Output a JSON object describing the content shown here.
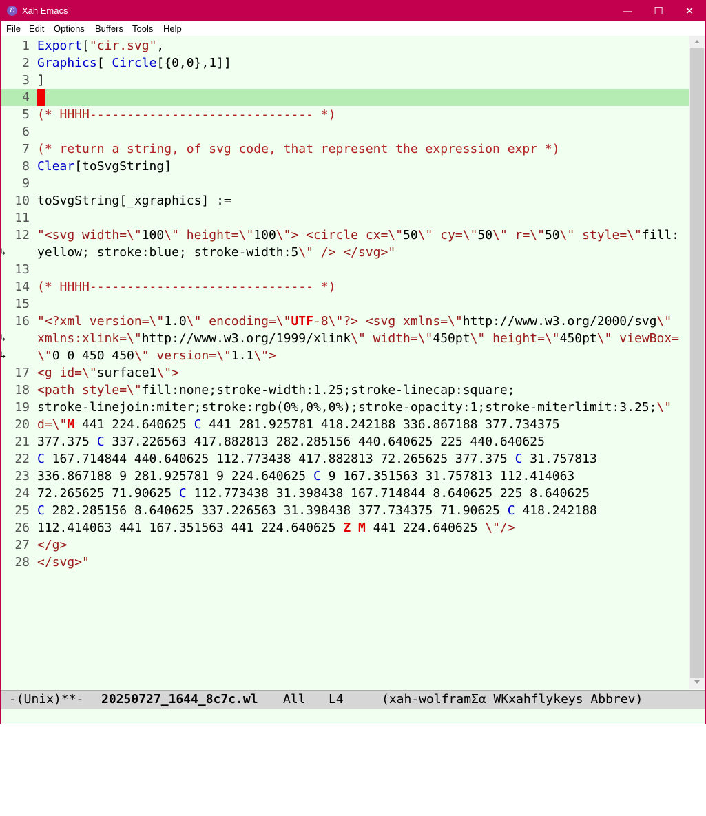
{
  "window": {
    "title": "Xah Emacs",
    "app_icon": "emacs-icon",
    "controls": {
      "minimize": "—",
      "maximize": "☐",
      "close": "✕"
    }
  },
  "menu": [
    "File",
    "Edit",
    "Options",
    "Buffers",
    "Tools",
    "Help"
  ],
  "lines": [
    "1",
    "2",
    "3",
    "4",
    "5",
    "6",
    "7",
    "8",
    "9",
    "10",
    "11",
    "12",
    "13",
    "14",
    "15",
    "16",
    "17",
    "18",
    "19",
    "20",
    "21",
    "22",
    "23",
    "24",
    "25",
    "26",
    "27",
    "28"
  ],
  "code": {
    "l1": {
      "a": "Export",
      "b": "[",
      "c": "\"cir.svg\"",
      "d": ","
    },
    "l2": {
      "a": "Graphics",
      "b": "[ ",
      "c": "Circle",
      "d": "[{0,0},1]]"
    },
    "l3": "]",
    "l5": "(* HHHH------------------------------ *)",
    "l7": "(* return a string, of svg code, that represent the expression expr *)",
    "l8": {
      "a": "Clear",
      "b": "[toSvgString]"
    },
    "l10": "toSvgString[_xgraphics] :=",
    "l12a": {
      "a": "\"<svg width=\\\"",
      "b": "100",
      "c": "\\\" height=\\\"",
      "d": "100",
      "e": "\\\"> <circle cx=\\\"",
      "f": "50",
      "g": "\\\" cy=\\\"",
      "h": "50",
      "i": "\\\" r=\\\"",
      "j": "50",
      "k": "\\\" style=\\\"",
      "l": "fill:"
    },
    "l12b": {
      "a": "yellow; stroke:blue; stroke-width:5",
      "b": "\\\" /> </svg>\""
    },
    "l14": "(* HHHH------------------------------ *)",
    "l16a": {
      "a": "\"<?xml version=\\\"",
      "b": "1.0",
      "c": "\\\" encoding=\\\"",
      "d": "UTF",
      "e": "-8\\\"?> <svg xmlns=\\\"",
      "f": "http://www.w3.org/2000/svg",
      "g": "\\\""
    },
    "l16b": {
      "a": "xmlns:xlink=\\\"",
      "b": "http://www.w3.org/1999/xlink",
      "c": "\\\" width=\\\"",
      "d": "450pt",
      "e": "\\\" height=\\\"",
      "f": "450pt",
      "g": "\\\" viewBox="
    },
    "l16c": {
      "a": "\\\"",
      "b": "0 0 450 450",
      "c": "\\\" version=\\\"",
      "d": "1.1",
      "e": "\\\">"
    },
    "l17": {
      "a": "<g id=\\\"",
      "b": "surface1",
      "c": "\\\">"
    },
    "l18": {
      "a": "<path style=\\\"",
      "b": "fill:none;stroke-width:1.25;stroke-linecap:square;"
    },
    "l19": {
      "a": "stroke-linejoin:miter;stroke:rgb(0%,0%,0%);stroke-opacity:1;stroke-miterlimit:3.25;",
      "b": "\\\""
    },
    "l20": {
      "a": "d=\\\"",
      "b": "M",
      "c": " 441 224.640625 ",
      "d": "C",
      "e": " 441 281.925781 418.242188 336.867188 377.734375"
    },
    "l21": {
      "a": "377.375 ",
      "b": "C",
      "c": " 337.226563 417.882813 282.285156 440.640625 225 440.640625"
    },
    "l22": {
      "a": "C",
      "b": " 167.714844 440.640625 112.773438 417.882813 72.265625 377.375 ",
      "c": "C",
      "d": " 31.757813"
    },
    "l23": {
      "a": "336.867188 9 281.925781 9 224.640625 ",
      "b": "C",
      "c": " 9 167.351563 31.757813 112.414063"
    },
    "l24": {
      "a": "72.265625 71.90625 ",
      "b": "C",
      "c": " 112.773438 31.398438 167.714844 8.640625 225 8.640625"
    },
    "l25": {
      "a": "C",
      "b": " 282.285156 8.640625 337.226563 31.398438 377.734375 71.90625 ",
      "c": "C",
      "d": " 418.242188"
    },
    "l26": {
      "a": "112.414063 441 167.351563 441 224.640625 ",
      "b": "Z",
      "c": " ",
      "d": "M",
      "e": " 441 224.640625 ",
      "f": "\\\"/>"
    },
    "l27": "</g>",
    "l28": "</svg>\""
  },
  "modeline": {
    "status": "-(Unix)**-",
    "filename": "20250727_1644_8c7c.wl",
    "position": "All",
    "line": "L4",
    "modes": "(xah-wolframΣα WKxahflykeys Abbrev)"
  },
  "colors": {
    "titlebar": "#c2004e",
    "editor_bg": "#f0fff0",
    "current_line": "#b4ecb4",
    "keyword": "#0000cc",
    "string": "#9b1a1a",
    "cursor": "#e00000"
  }
}
